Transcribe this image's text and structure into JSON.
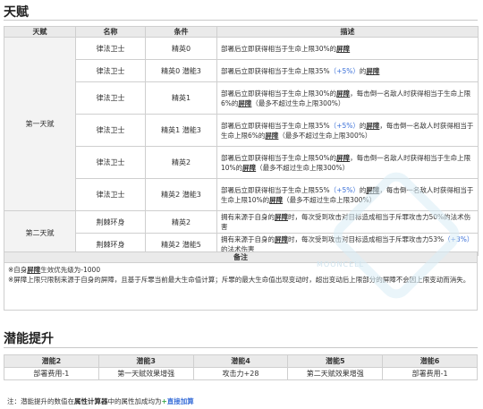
{
  "sections": {
    "talent_title": "天赋",
    "potential_title": "潜能提升"
  },
  "talent_table": {
    "headers": [
      "天赋",
      "名称",
      "条件",
      "描述"
    ],
    "groups": [
      {
        "name": "第一天赋",
        "rows": [
          {
            "name": "律法卫士",
            "cond": "精英0",
            "desc": [
              {
                "t": "部署后立即获得相当于生命上限30%的"
              },
              {
                "t": "屏障",
                "s": "shield"
              }
            ]
          },
          {
            "name": "律法卫士",
            "cond": "精英0 潜能3",
            "desc": [
              {
                "t": "部署后立即获得相当于生命上限35%"
              },
              {
                "t": "（+5%）",
                "s": "hl"
              },
              {
                "t": "的"
              },
              {
                "t": "屏障",
                "s": "shield"
              }
            ]
          },
          {
            "name": "律法卫士",
            "cond": "精英1",
            "desc": [
              {
                "t": "部署后立即获得相当于生命上限30%的"
              },
              {
                "t": "屏障",
                "s": "shield"
              },
              {
                "t": "，每击倒一名敌人时获得相当于生命上限6%的"
              },
              {
                "t": "屏障",
                "s": "shield"
              },
              {
                "t": "（最多不超过生命上限300%）"
              }
            ]
          },
          {
            "name": "律法卫士",
            "cond": "精英1 潜能3",
            "desc": [
              {
                "t": "部署后立即获得相当于生命上限35%"
              },
              {
                "t": "（+5%）",
                "s": "hl"
              },
              {
                "t": "的"
              },
              {
                "t": "屏障",
                "s": "shield"
              },
              {
                "t": "，每击倒一名敌人时获得相当于生命上限6%的"
              },
              {
                "t": "屏障",
                "s": "shield"
              },
              {
                "t": "（最多不超过生命上限300%）"
              }
            ]
          },
          {
            "name": "律法卫士",
            "cond": "精英2",
            "desc": [
              {
                "t": "部署后立即获得相当于生命上限50%的"
              },
              {
                "t": "屏障",
                "s": "shield"
              },
              {
                "t": "，每击倒一名敌人时获得相当于生命上限10%的"
              },
              {
                "t": "屏障",
                "s": "shield"
              },
              {
                "t": "（最多不超过生命上限300%）"
              }
            ]
          },
          {
            "name": "律法卫士",
            "cond": "精英2 潜能3",
            "desc": [
              {
                "t": "部署后立即获得相当于生命上限55%"
              },
              {
                "t": "（+5%）",
                "s": "hl"
              },
              {
                "t": "的"
              },
              {
                "t": "屏障",
                "s": "shield"
              },
              {
                "t": "，每击倒一名敌人时获得相当于生命上限10%的"
              },
              {
                "t": "屏障",
                "s": "shield"
              },
              {
                "t": "（最多不超过生命上限300%）"
              }
            ]
          }
        ]
      },
      {
        "name": "第二天赋",
        "rows": [
          {
            "name": "荆棘环身",
            "cond": "精英2",
            "desc": [
              {
                "t": "拥有来源于自身的"
              },
              {
                "t": "屏障",
                "s": "shield"
              },
              {
                "t": "时，每次受到攻击对目标造成相当于斥罪攻击力50%的法术伤害"
              }
            ]
          },
          {
            "name": "荆棘环身",
            "cond": "精英2 潜能5",
            "desc": [
              {
                "t": "拥有来源于自身的"
              },
              {
                "t": "屏障",
                "s": "shield"
              },
              {
                "t": "时，每次受到攻击对目标造成相当于斥罪攻击力53%"
              },
              {
                "t": "（+3%）",
                "s": "hl"
              },
              {
                "t": "的法术伤害"
              }
            ]
          }
        ]
      }
    ]
  },
  "notes": {
    "header": "备注",
    "lines": [
      [
        {
          "t": "※自身"
        },
        {
          "t": "屏障",
          "s": "shield"
        },
        {
          "t": "生效优先级为-1000"
        }
      ],
      [
        {
          "t": "※屏障上限只限制来源于自身的屏障，且基于斥罪当前最大生命值计算；斥罪的最大生命值出现变动时，超出变动后上限部分的屏障不会因上限变动而消失。"
        }
      ]
    ]
  },
  "potential_table": {
    "headers": [
      "潜能2",
      "潜能3",
      "潜能4",
      "潜能5",
      "潜能6"
    ],
    "values": [
      "部署费用-1",
      "第一天赋效果增强",
      "攻击力+28",
      "第二天赋效果增强",
      "部署费用-1"
    ]
  },
  "footnote": {
    "prefix": "注：潜能提升的数值在",
    "bold": "属性计算器",
    "middle": "中的属性加成均为",
    "plus": "+",
    "link": "直接加算"
  },
  "watermark": "MOONCELL"
}
